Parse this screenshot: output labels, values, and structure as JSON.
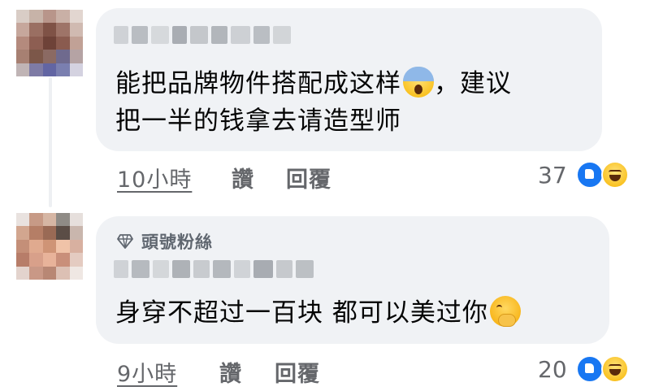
{
  "comments": [
    {
      "badge": "",
      "text_line1": "能把品牌物件搭配成这样",
      "emoji1": "face-screaming-in-fear-icon",
      "text_line1_tail": "，建议",
      "text_line2": "把一半的钱拿去请造型师",
      "time": "10小時",
      "like_label": "讚",
      "reply_label": "回覆",
      "reaction_count": "37",
      "reactions": [
        "like-reaction-icon",
        "haha-reaction-icon"
      ]
    },
    {
      "badge": "頭號粉絲",
      "badge_icon": "diamond-icon",
      "text_line1": "身穿不超过一百块 都可以美过你",
      "emoji1": "face-with-hand-over-mouth-icon",
      "time": "9小時",
      "like_label": "讚",
      "reply_label": "回覆",
      "reaction_count": "20",
      "reactions": [
        "like-reaction-icon",
        "haha-reaction-icon"
      ]
    }
  ],
  "colors": {
    "bubble": "#f0f2f5",
    "meta_text": "#65676b",
    "like_blue": "#1877f2",
    "badge_text": "#606770"
  }
}
